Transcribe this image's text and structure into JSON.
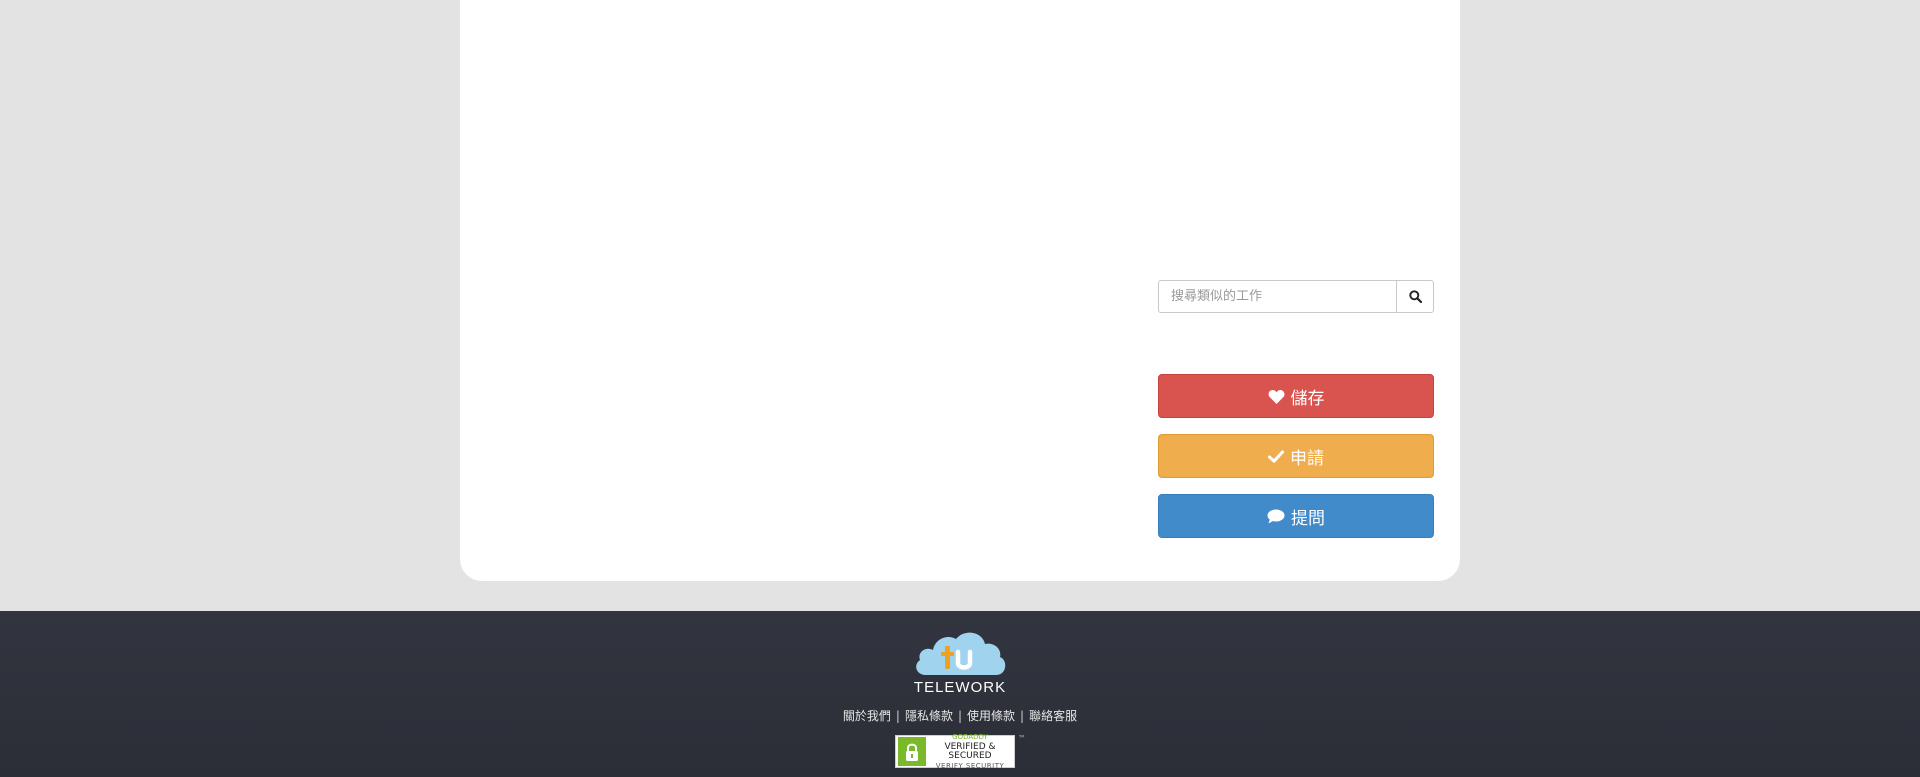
{
  "search": {
    "placeholder": "搜尋類似的工作",
    "icon": "search-icon"
  },
  "actions": {
    "save": {
      "label": "儲存",
      "icon": "heart-icon",
      "color": "#d9534f"
    },
    "apply": {
      "label": "申請",
      "icon": "check-icon",
      "color": "#f0ad4e"
    },
    "ask": {
      "label": "提問",
      "icon": "comment-icon",
      "color": "#428bca"
    }
  },
  "footer": {
    "logo_text": "TELEWORK",
    "links": [
      "關於我們",
      "隱私條款",
      "使用條款",
      "聯絡客服"
    ],
    "separator": "|",
    "seal": {
      "brand": "GODADDY",
      "main": "VERIFIED & SECURED",
      "sub": "VERIFY SECURITY"
    }
  }
}
